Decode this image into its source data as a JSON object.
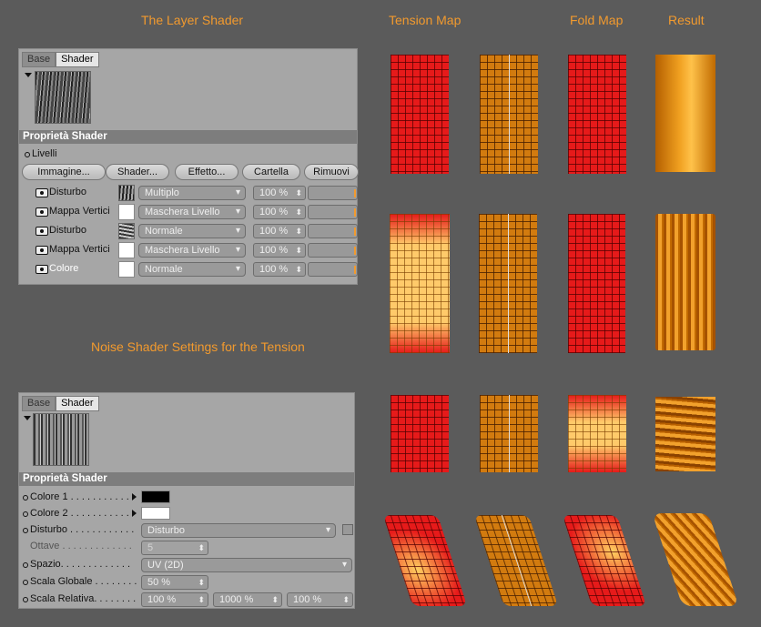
{
  "headings": {
    "layer_shader": "The Layer Shader",
    "tension_map": "Tension Map",
    "fold_map": "Fold Map",
    "result": "Result",
    "noise_settings": "Noise Shader Settings for the Tension"
  },
  "layer_panel": {
    "tabs": [
      "Base",
      "Shader"
    ],
    "section_title": "Proprietà Shader",
    "livelli_label": "Livelli",
    "buttons": [
      "Immagine...",
      "Shader...",
      "Effetto...",
      "Cartella",
      "Rimuovi"
    ],
    "layers": [
      {
        "name": "Disturbo",
        "mode": "Multiplo",
        "amount": "100 %"
      },
      {
        "name": "Mappa Vertici",
        "mode": "Maschera Livello",
        "amount": "100 %"
      },
      {
        "name": "Disturbo",
        "mode": "Normale",
        "amount": "100 %"
      },
      {
        "name": "Mappa Vertici",
        "mode": "Maschera Livello",
        "amount": "100 %"
      },
      {
        "name": "Colore",
        "mode": "Normale",
        "amount": "100 %"
      }
    ]
  },
  "noise_panel": {
    "tabs": [
      "Base",
      "Shader"
    ],
    "section_title": "Proprietà Shader",
    "colore1_label": "Colore 1 . . . . . . . . . . .",
    "colore2_label": "Colore 2 . . . . . . . . . . .",
    "disturbo_label": "Disturbo . . . . . . . . . . . .",
    "disturbo_value": "Disturbo",
    "ottave_label": "Ottave . . . . . . . . . . . . .",
    "ottave_value": "5",
    "spazio_label": "Spazio. . . . . . . . . . . . .",
    "spazio_value": "UV (2D)",
    "scala_globale_label": "Scala Globale . . . . . . . .",
    "scala_globale_value": "50 %",
    "scala_relativa_label": "Scala Relativa. . . . . . . .",
    "scala_relativa_values": [
      "100 %",
      "1000 %",
      "100 %"
    ]
  },
  "colors": {
    "accent": "#f29a2e",
    "tension_red": "#e61a1a",
    "mesh_orange": "#d27b0f"
  }
}
